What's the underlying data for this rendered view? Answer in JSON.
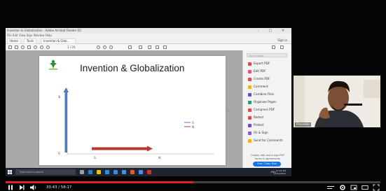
{
  "window": {
    "title": "Invention & Globalization - Adobe Acrobat Reader DC",
    "menu": "File  Edit  View  Sign  Window  Help",
    "controls": "–  □  ✕"
  },
  "tabs": [
    "Home",
    "Tools",
    "Invention & Glob..."
  ],
  "signin": "Sign in",
  "toolbar": {
    "zoom": "1 / 26"
  },
  "slide": {
    "title": "Invention & Globalization",
    "y_axis_label": "$",
    "x_axis_labels": [
      "0",
      "S",
      "N"
    ],
    "legend": [
      "S",
      "N"
    ]
  },
  "colors": {
    "axis_blue": "#4a7ebb",
    "arrow_red": "#c0392b",
    "progress": "#e62117"
  },
  "right_panel": {
    "search_placeholder": "Search tools",
    "items": [
      {
        "label": "Export PDF",
        "color": "#e34850"
      },
      {
        "label": "Edit PDF",
        "color": "#ea4d85"
      },
      {
        "label": "Create PDF",
        "color": "#e34850"
      },
      {
        "label": "Comment",
        "color": "#f2b200"
      },
      {
        "label": "Combine Files",
        "color": "#6d48c8"
      },
      {
        "label": "Organize Pages",
        "color": "#2d9d78"
      },
      {
        "label": "Compress PDF",
        "color": "#e34850"
      },
      {
        "label": "Redact",
        "color": "#e34850"
      },
      {
        "label": "Protect",
        "color": "#6d48c8"
      },
      {
        "label": "Fill & Sign",
        "color": "#8a59d0"
      },
      {
        "label": "Send for Comments",
        "color": "#f2b200"
      }
    ],
    "caption": "Create, edit and e-sign PDF forms & agreements",
    "button": "Free 7-Day Trial"
  },
  "taskbar": {
    "search_placeholder": "Type here to search",
    "tray": "ENG",
    "clock_time": "11:18 AM",
    "clock_date": "12/11/2021"
  },
  "webcam": {
    "name": "Presenter"
  },
  "player": {
    "time": "33:43 / 58:17",
    "progress": 0.5
  }
}
